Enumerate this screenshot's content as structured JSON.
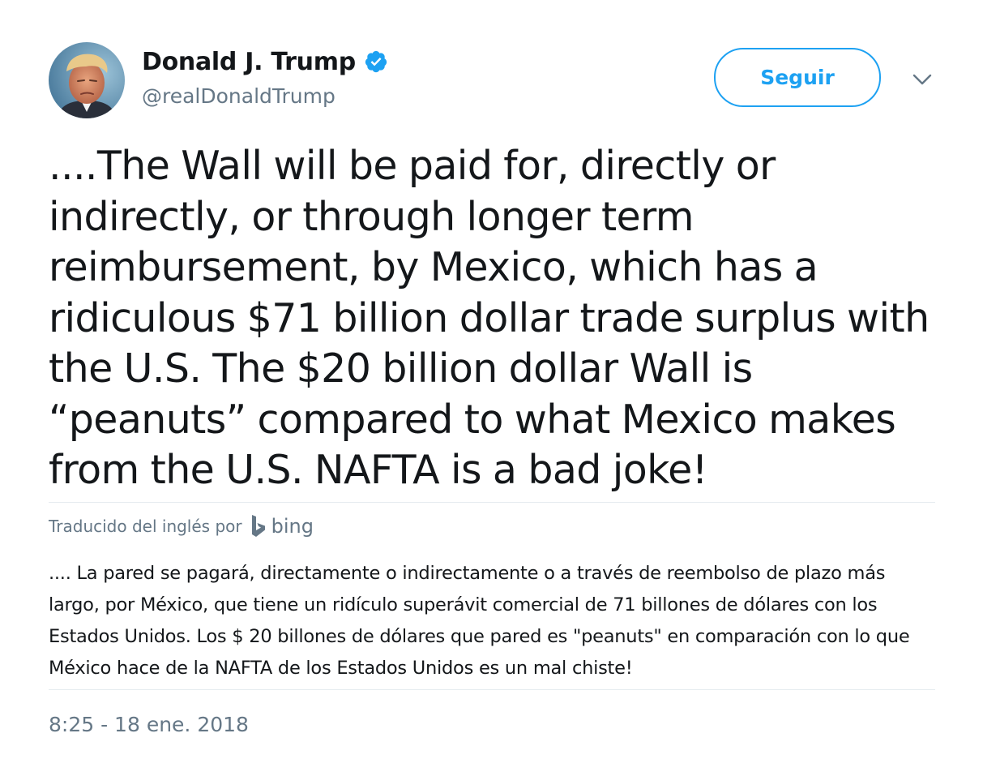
{
  "author": {
    "name": "Donald J. Trump",
    "handle": "@realDonaldTrump",
    "verified": true
  },
  "actions": {
    "follow_label": "Seguir"
  },
  "tweet": {
    "text": "....The Wall will be paid for, directly or indirectly, or through longer term reimbursement, by Mexico, which has a ridiculous $71 billion dollar trade surplus with the U.S. The $20 billion dollar Wall is “peanuts” compared to what Mexico makes from the U.S. NAFTA is a bad joke!",
    "translated_label": "Traducido del inglés por",
    "translator_name": "bing",
    "translation": ".... La pared se pagará, directamente o indirectamente o a través de reembolso de plazo más largo, por México, que tiene un ridículo superávit comercial de 71 billones de dólares con los Estados Unidos. Los $ 20 billones de dólares que pared es \"peanuts\" en comparación con lo que México hace de la NAFTA de los Estados Unidos es un mal chiste!",
    "timestamp": "8:25 - 18 ene. 2018"
  },
  "icons": {
    "verified": "verified-badge-icon",
    "more": "chevron-down-icon",
    "translator": "bing-logo-icon"
  },
  "colors": {
    "accent": "#1da1f2",
    "secondary_text": "#657786",
    "primary_text": "#14171a",
    "divider": "#e6ecf0"
  }
}
